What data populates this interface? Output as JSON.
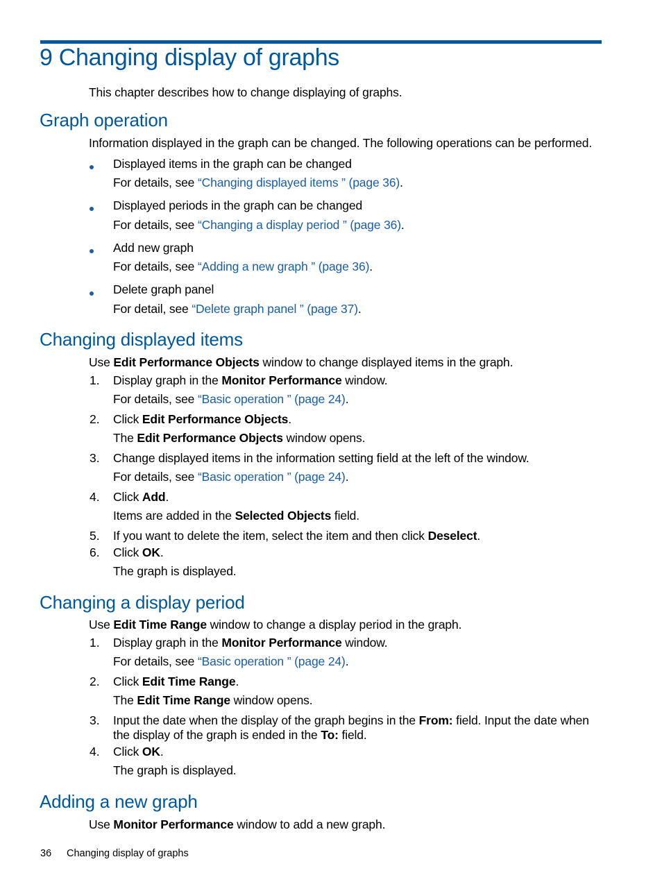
{
  "page": {
    "chapter_title": "9 Changing display of graphs",
    "intro": "This chapter describes how to change displaying of graphs.",
    "accent_color": "#00579c",
    "link_color": "#1a5ea8"
  },
  "graph_operation": {
    "heading": "Graph operation",
    "intro": "Information displayed in the graph can be changed. The following operations can be performed.",
    "items": [
      {
        "text": "Displayed items in the graph can be changed",
        "prefix": "For details, see ",
        "link": "“Changing displayed items ” (page 36)",
        "suffix": "."
      },
      {
        "text": "Displayed periods in the graph can be changed",
        "prefix": "For details, see ",
        "link": "“Changing a display period ” (page 36)",
        "suffix": "."
      },
      {
        "text": "Add new graph",
        "prefix": "For details, see ",
        "link": "“Adding a new graph ” (page 36)",
        "suffix": "."
      },
      {
        "text": "Delete graph panel",
        "prefix": "For detail, see ",
        "link": "“Delete graph panel ” (page 37)",
        "suffix": "."
      }
    ]
  },
  "changing_items": {
    "heading": "Changing displayed items",
    "intro": {
      "pre": "Use ",
      "bold": "Edit Performance Objects",
      "post": " window to change displayed items in the graph."
    },
    "steps": [
      {
        "num": "1.",
        "pre": "Display graph in the ",
        "bold": "Monitor Performance",
        "post": " window."
      },
      {
        "sub_prefix": "For details, see ",
        "sub_link": "“Basic operation ” (page 24)",
        "sub_suffix": "."
      },
      {
        "num": "2.",
        "pre": "Click ",
        "bold": "Edit Performance Objects",
        "post": "."
      },
      {
        "sub_pre": "The ",
        "sub_bold": "Edit Performance Objects",
        "sub_post": " window opens."
      },
      {
        "num": "3.",
        "text": "Change displayed items in the information setting field at the left of the window."
      },
      {
        "sub_prefix": "For details, see ",
        "sub_link": "“Basic operation ” (page 24)",
        "sub_suffix": "."
      },
      {
        "num": "4.",
        "pre": "Click ",
        "bold": "Add",
        "post": "."
      },
      {
        "sub_pre": "Items are added in the ",
        "sub_bold": "Selected Objects",
        "sub_post": " field."
      },
      {
        "num": "5.",
        "pre": "If you want to delete the item, select the item and then click ",
        "bold": "Deselect",
        "post": "."
      },
      {
        "num": "6.",
        "pre": "Click ",
        "bold": "OK",
        "post": "."
      },
      {
        "sub_text": "The graph is displayed."
      }
    ]
  },
  "changing_period": {
    "heading": "Changing a display period",
    "intro": {
      "pre": "Use ",
      "bold": "Edit Time Range",
      "post": " window to change a display period in the graph."
    },
    "steps": [
      {
        "num": "1.",
        "pre": "Display graph in the ",
        "bold": "Monitor Performance",
        "post": " window."
      },
      {
        "sub_prefix": "For details, see ",
        "sub_link": "“Basic operation ” (page 24)",
        "sub_suffix": "."
      },
      {
        "num": "2.",
        "pre": "Click ",
        "bold": "Edit Time Range",
        "post": "."
      },
      {
        "sub_pre": "The ",
        "sub_bold": "Edit Time Range",
        "sub_post": " window opens."
      },
      {
        "num": "3.",
        "pre": "Input the date when the display of the graph begins in the ",
        "bold": "From:",
        "post": " field. Input the date when",
        "line2_pre": "the display of the graph is ended in the ",
        "line2_bold": "To:",
        "line2_post": " field."
      },
      {
        "num": "4.",
        "pre": "Click ",
        "bold": "OK",
        "post": "."
      },
      {
        "sub_text": "The graph is displayed."
      }
    ]
  },
  "adding_graph": {
    "heading": "Adding a new graph",
    "intro": {
      "pre": "Use ",
      "bold": "Monitor Performance",
      "post": " window to add a new graph."
    }
  },
  "footer": {
    "page_number": "36",
    "title": "Changing display of graphs"
  }
}
